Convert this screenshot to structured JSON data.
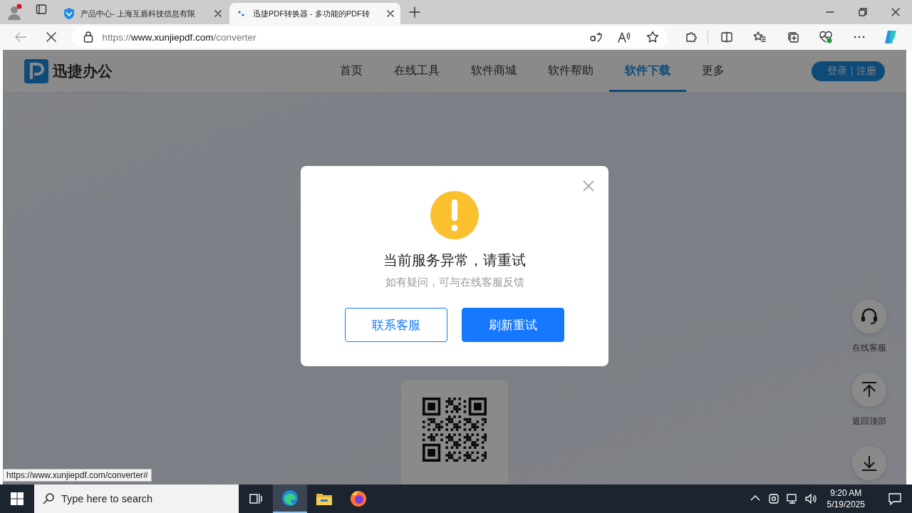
{
  "browser": {
    "tabs": [
      {
        "title": "产品中心- 上海互盾科技信息有限",
        "selected": false
      },
      {
        "title": "迅捷PDF转换器 - 多功能的PDF转",
        "selected": true
      }
    ],
    "address": {
      "host": "https://www.xunjiepdf.com",
      "path": "/converter"
    }
  },
  "page": {
    "logo": "迅捷办公",
    "nav": [
      {
        "label": "首页",
        "selected": false
      },
      {
        "label": "在线工具",
        "selected": false
      },
      {
        "label": "软件商城",
        "selected": false
      },
      {
        "label": "软件帮助",
        "selected": false
      },
      {
        "label": "软件下载",
        "selected": true
      },
      {
        "label": "更多",
        "selected": false
      }
    ],
    "login": "登录",
    "register": "注册",
    "side_buttons": [
      {
        "kind": "headset",
        "label": "在线客服"
      },
      {
        "kind": "top",
        "label": "返回顶部"
      },
      {
        "kind": "download"
      }
    ]
  },
  "dialog": {
    "title": "当前服务异常，请重试",
    "message": "如有疑问，可与在线客服反馈",
    "buttons": [
      {
        "kind": "secondary",
        "label": "联系客服"
      },
      {
        "kind": "primary",
        "label": "刷新重试"
      }
    ]
  },
  "status_url": "https://www.xunjiepdf.com/converter#",
  "taskbar": {
    "search_placeholder": "Type here to search",
    "time": "9:20 AM",
    "date": "5/19/2025"
  }
}
